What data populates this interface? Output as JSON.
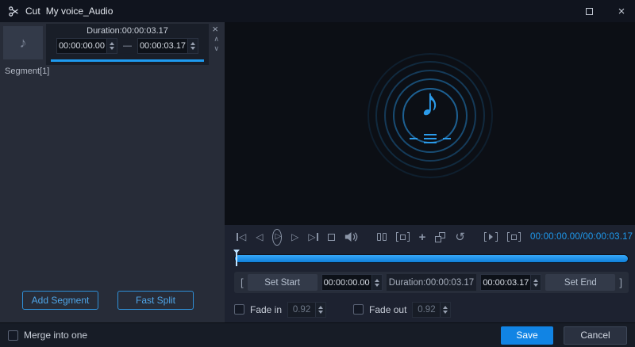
{
  "window": {
    "title": "Cut",
    "file_name": "My voice_Audio"
  },
  "left_panel": {
    "duration_label": "Duration:00:00:03.17",
    "start_value": "00:00:00.00",
    "end_value": "00:00:03.17",
    "separator": "—",
    "segment_label": "Segment[1]",
    "add_segment": "Add Segment",
    "fast_split": "Fast Split"
  },
  "player": {
    "time_display": "00:00:00.00/00:00:03.17"
  },
  "edit_bar": {
    "bracket_open": "[",
    "set_start": "Set Start",
    "start_value": "00:00:00.00",
    "duration_label": "Duration:00:00:03.17",
    "end_value": "00:00:03.17",
    "set_end": "Set End",
    "bracket_close": "]"
  },
  "fade": {
    "fade_in_label": "Fade in",
    "fade_in_value": "0.92",
    "fade_out_label": "Fade out",
    "fade_out_value": "0.92"
  },
  "footer": {
    "merge_label": "Merge into one",
    "save": "Save",
    "cancel": "Cancel"
  },
  "icons": {
    "close": "×",
    "note": "♪",
    "prev": "◁",
    "next": "▷",
    "play": "▷",
    "plus": "+",
    "reset": "↺",
    "chevron_up": "∧",
    "chevron_down": "∨"
  },
  "colors": {
    "accent_blue": "#1e9bf0",
    "save_button_blue": "#1184e4",
    "preview_bg": "#0c0f15",
    "panel_bg": "#272c38",
    "titlebar_bg": "#10141e"
  }
}
